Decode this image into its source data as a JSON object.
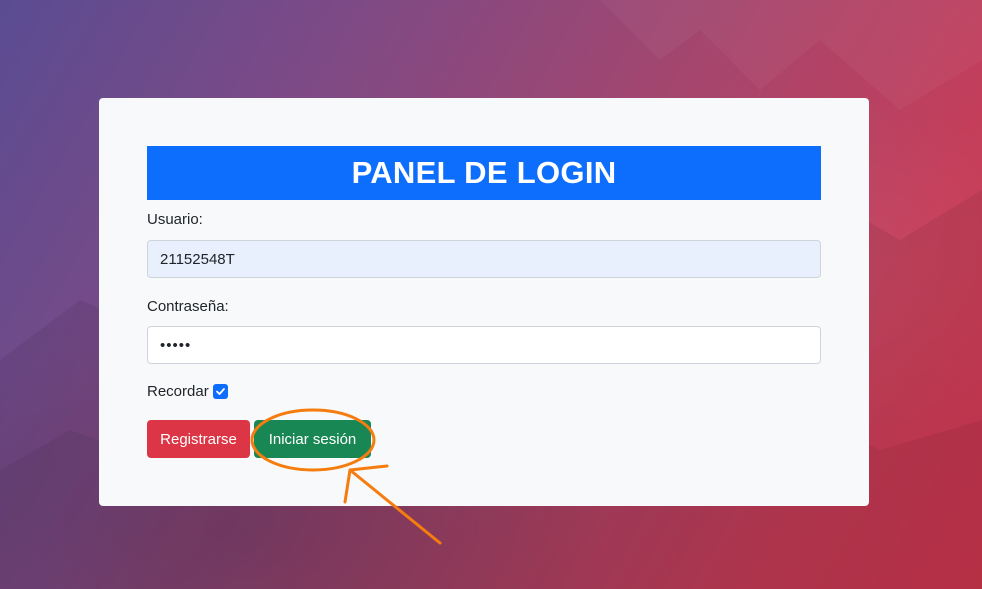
{
  "login_panel": {
    "title": "PANEL DE LOGIN",
    "username_label": "Usuario:",
    "username_value": "21152548T",
    "password_label": "Contraseña:",
    "password_value": "12345",
    "remember_label": "Recordar",
    "remember_checked": true,
    "register_button": "Registrarse",
    "login_button": "Iniciar sesión"
  },
  "colors": {
    "title_bar": "#0d6efd",
    "register_button": "#dc3545",
    "login_button": "#198754",
    "annotation": "#f57c0f"
  },
  "icons": {
    "checkbox": "check-icon"
  }
}
